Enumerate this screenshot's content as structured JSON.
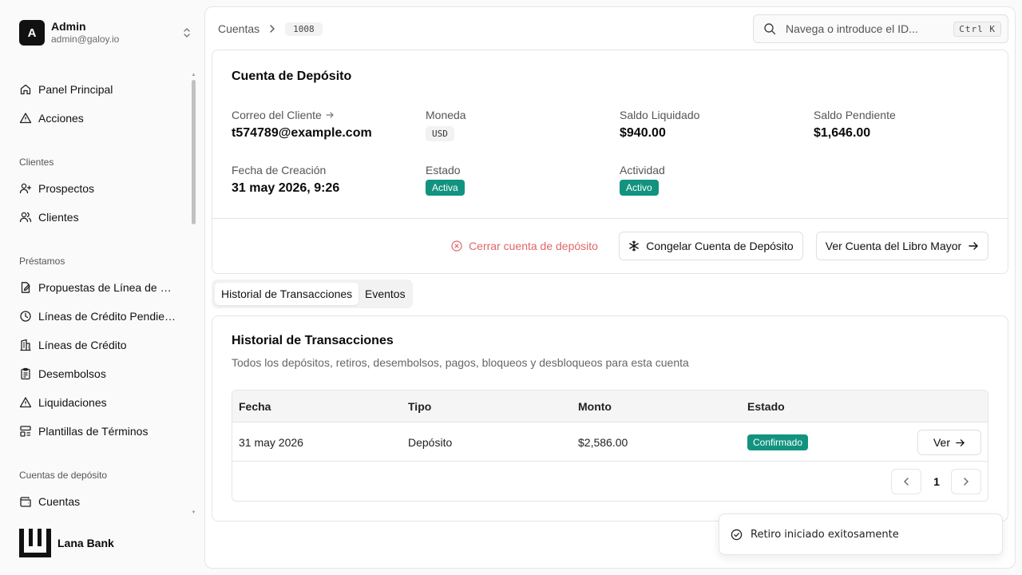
{
  "user": {
    "initial": "A",
    "name": "Admin",
    "email": "admin@galoy.io"
  },
  "nav": {
    "items_top": [
      {
        "label": "Panel Principal",
        "icon": "home-icon"
      },
      {
        "label": "Acciones",
        "icon": "alert-triangle-icon"
      }
    ],
    "group_clientes": "Clientes",
    "clientes": [
      {
        "label": "Prospectos",
        "icon": "user-plus-icon"
      },
      {
        "label": "Clientes",
        "icon": "users-icon"
      }
    ],
    "group_prestamos": "Préstamos",
    "prestamos": [
      {
        "label": "Propuestas de Línea de Cr...",
        "icon": "file-edit-icon"
      },
      {
        "label": "Líneas de Crédito Pendient...",
        "icon": "clock-icon"
      },
      {
        "label": "Líneas de Crédito",
        "icon": "building-icon"
      },
      {
        "label": "Desembolsos",
        "icon": "clipboard-icon"
      },
      {
        "label": "Liquidaciones",
        "icon": "alert-triangle-icon"
      },
      {
        "label": "Plantillas de Términos",
        "icon": "layout-icon"
      }
    ],
    "group_depositos": "Cuentas de depósito",
    "depositos": [
      {
        "label": "Cuentas",
        "icon": "wallet-icon"
      }
    ]
  },
  "brand": {
    "name": "Lana Bank"
  },
  "breadcrumb": {
    "parent": "Cuentas",
    "current_id": "1008"
  },
  "search": {
    "placeholder": "Navega o introduce el ID...",
    "shortcut": "Ctrl K"
  },
  "account": {
    "title": "Cuenta de Depósito",
    "email_label": "Correo del Cliente",
    "email_value": "t574789@example.com",
    "currency_label": "Moneda",
    "currency_value": "USD",
    "settled_label": "Saldo Liquidado",
    "settled_value": "$940.00",
    "pending_label": "Saldo Pendiente",
    "pending_value": "$1,646.00",
    "created_label": "Fecha de Creación",
    "created_value": "31 may 2026, 9:26",
    "status_label": "Estado",
    "status_value": "Activa",
    "activity_label": "Actividad",
    "activity_value": "Activo",
    "close_label": "Cerrar cuenta de depósito",
    "freeze_label": "Congelar Cuenta de Depósito",
    "ledger_label": "Ver Cuenta del Libro Mayor"
  },
  "tabs": [
    {
      "label": "Historial de Transacciones",
      "active": true
    },
    {
      "label": "Eventos",
      "active": false
    }
  ],
  "transactions": {
    "title": "Historial de Transacciones",
    "description": "Todos los depósitos, retiros, desembolsos, pagos, bloqueos y desbloqueos para esta cuenta",
    "columns": [
      "Fecha",
      "Tipo",
      "Monto",
      "Estado"
    ],
    "rows": [
      {
        "date": "31 may 2026",
        "type": "Depósito",
        "amount": "$2,586.00",
        "status": "Confirmado",
        "action": "Ver"
      }
    ],
    "page": "1"
  },
  "toast": {
    "message": "Retiro iniciado exitosamente"
  },
  "colors": {
    "accent_green": "#12937f",
    "danger": "#e06666"
  }
}
